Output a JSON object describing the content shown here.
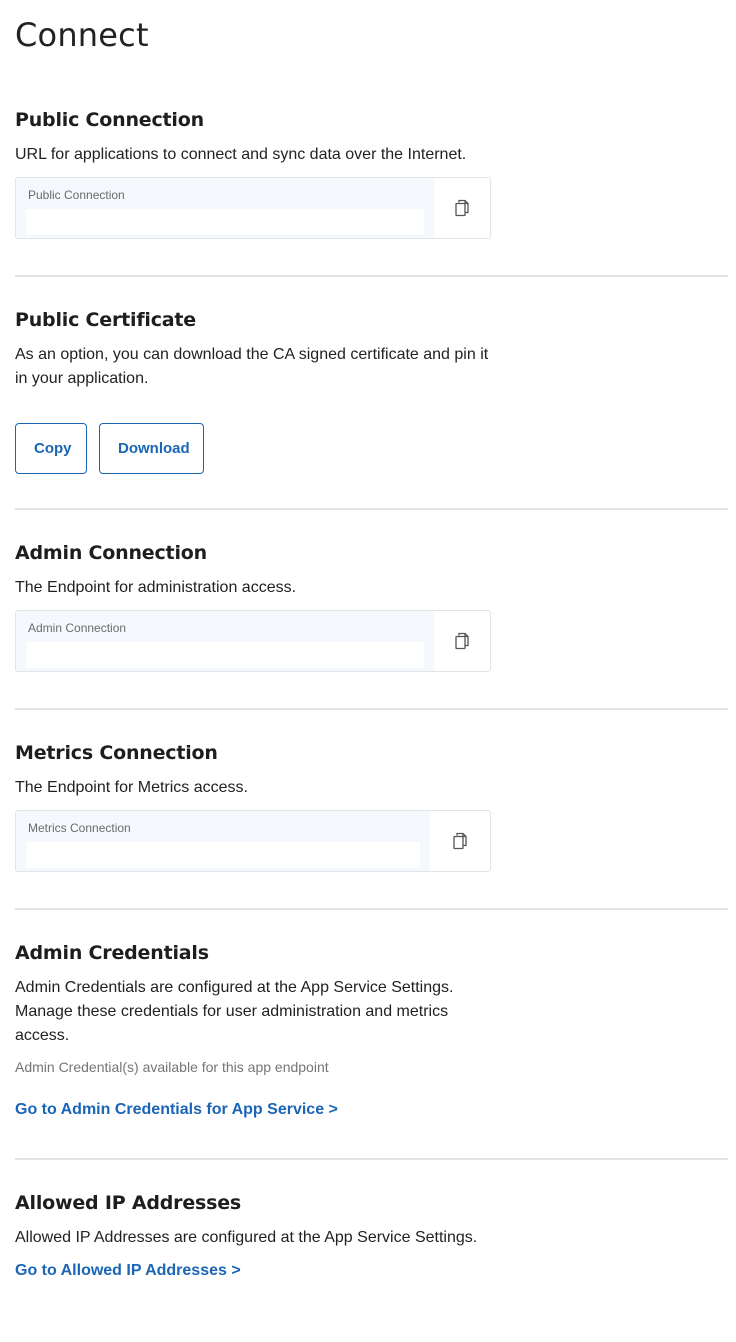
{
  "page": {
    "title": "Connect"
  },
  "public_connection": {
    "heading": "Public Connection",
    "description": "URL for applications to connect and sync data over the Internet.",
    "field_label": "Public Connection",
    "field_value": "",
    "copy_icon": "copy-icon"
  },
  "public_certificate": {
    "heading": "Public Certificate",
    "description": "As an option, you can download the CA signed certificate and pin it in your application.",
    "copy_label": "Copy",
    "download_label": "Download"
  },
  "admin_connection": {
    "heading": "Admin Connection",
    "description": "The Endpoint for administration access.",
    "field_label": "Admin Connection",
    "field_value": "",
    "copy_icon": "copy-icon"
  },
  "metrics_connection": {
    "heading": "Metrics Connection",
    "description": "The Endpoint for Metrics access.",
    "field_label": "Metrics Connection",
    "field_value": "",
    "copy_icon": "copy-icon"
  },
  "admin_credentials": {
    "heading": "Admin Credentials",
    "description": "Admin Credentials are configured at the App Service Settings. Manage these credentials for user administration and metrics access.",
    "note": "Admin Credential(s) available for this app endpoint",
    "link_label": "Go to Admin Credentials for App Service >"
  },
  "allowed_ip": {
    "heading": "Allowed IP Addresses",
    "description": "Allowed IP Addresses are configured at the App Service Settings.",
    "link_label": "Go to Allowed IP Addresses >"
  },
  "colors": {
    "accent": "#1a65b5",
    "field_bg": "#f5f8fd",
    "divider": "#e3e3e3",
    "note_text": "#757575"
  }
}
